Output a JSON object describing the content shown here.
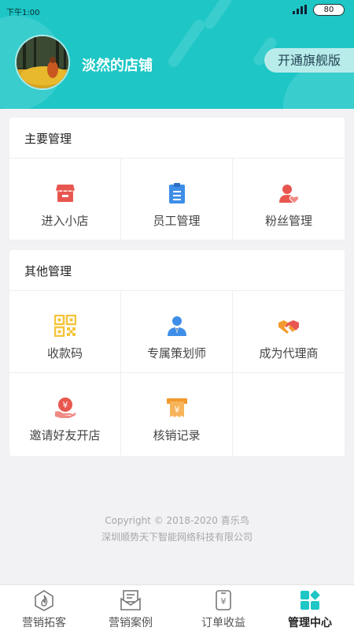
{
  "status_bar": {
    "time": "下午1:00",
    "battery": "80"
  },
  "header": {
    "shop_name": "淡然的店铺",
    "upgrade_label": "开通旗舰版"
  },
  "main_section": {
    "title": "主要管理",
    "items": [
      {
        "label": "进入小店",
        "icon": "storefront-icon"
      },
      {
        "label": "员工管理",
        "icon": "clipboard-icon"
      },
      {
        "label": "粉丝管理",
        "icon": "user-heart-icon"
      }
    ]
  },
  "other_section": {
    "title": "其他管理",
    "items": [
      {
        "label": "收款码",
        "icon": "qr-code-icon"
      },
      {
        "label": "专属策划师",
        "icon": "planner-icon"
      },
      {
        "label": "成为代理商",
        "icon": "handshake-icon"
      },
      {
        "label": "邀请好友开店",
        "icon": "invite-yen-icon"
      },
      {
        "label": "核销记录",
        "icon": "receipt-yen-icon"
      }
    ]
  },
  "footer": {
    "copyright": "Copyright © 2018-2020 喜乐鸟",
    "company": "深圳顺势天下智能网络科技有限公司"
  },
  "tabbar": {
    "tabs": [
      {
        "label": "营销拓客",
        "icon": "flame-icon",
        "active": false
      },
      {
        "label": "营销案例",
        "icon": "mail-icon",
        "active": false
      },
      {
        "label": "订单收益",
        "icon": "yen-phone-icon",
        "active": false
      },
      {
        "label": "管理中心",
        "icon": "grid-icon",
        "active": true
      }
    ]
  },
  "colors": {
    "header_bg": "#1ec6c6",
    "active_tab": "#1ec6c6",
    "red_icon": "#e8574f",
    "blue_icon": "#3e8ee8",
    "orange_icon": "#f29a2e",
    "yellow_icon": "#f5c43c"
  }
}
